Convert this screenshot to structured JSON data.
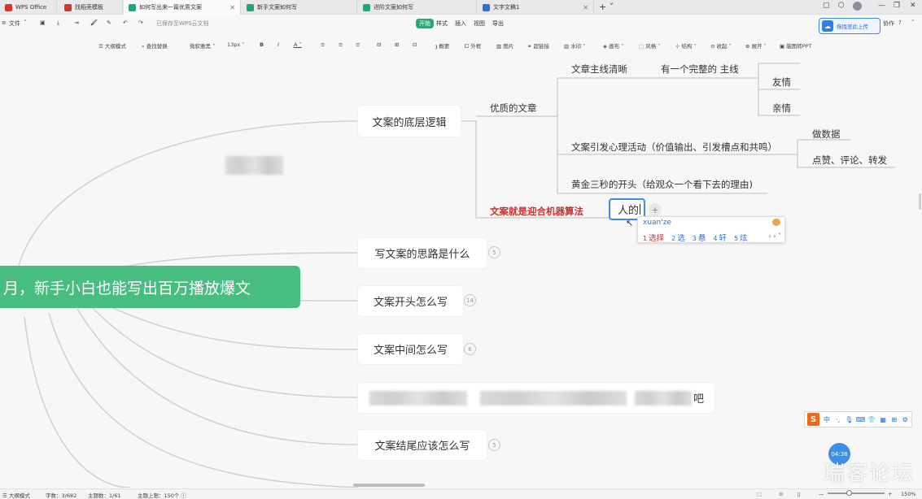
{
  "tabs": [
    {
      "label": "WPS Office",
      "active": false
    },
    {
      "label": "找稻壳模板",
      "active": false
    },
    {
      "label": "如何写出来一篇优质文案",
      "active": true
    },
    {
      "label": "新手文案如何写",
      "active": false
    },
    {
      "label": "进阶文案如何写",
      "active": false
    },
    {
      "label": "文字文稿1",
      "active": false
    }
  ],
  "toolbar1": {
    "file_menu": "文件",
    "saved_status": "已保存至WPS云文档",
    "menu_tabs": [
      "开始",
      "样式",
      "插入",
      "视图",
      "导出"
    ],
    "right_label": "协作",
    "upload_label": "拖拽至此上传"
  },
  "toolbar2": {
    "items": [
      "大纲模式",
      "查找替换",
      "微软雅黑",
      "13px",
      "B",
      "I",
      "A",
      "概要",
      "外框",
      "图片",
      "超链接",
      "水印",
      "画布",
      "风格",
      "结构",
      "收起",
      "展开",
      "脑图转PPT"
    ]
  },
  "mindmap": {
    "root": "月，新手小白也能写出百万播放爆文",
    "branches": [
      {
        "label": "文案的底层逻辑",
        "badge": ""
      },
      {
        "label": "写文案的思路是什么",
        "badge": "5"
      },
      {
        "label": "文案开头怎么写",
        "badge": "14"
      },
      {
        "label": "文案中间怎么写",
        "badge": "6"
      },
      {
        "label": "文案结尾应该怎么写",
        "badge": "5"
      }
    ],
    "sub": {
      "quality": "优质的文章",
      "algorithm": "文案就是迎合机器算法",
      "mainline": "文章主线清晰",
      "complete": "有一个完整的 主线",
      "friendship": "友情",
      "family": "亲情",
      "psych": "文案引发心理活动（价值输出、引发槽点和共鸣）",
      "data": "做数据",
      "engage": "点赞、评论、转发",
      "golden": "黄金三秒的开头（给观众一个看下去的理由)",
      "editing_text": "人的"
    },
    "blurred_tail": "吧"
  },
  "ime": {
    "pinyin": "xuan'ze",
    "candidates": [
      {
        "n": "1",
        "text": "选择"
      },
      {
        "n": "2",
        "text": "选"
      },
      {
        "n": "3",
        "text": "悬"
      },
      {
        "n": "4",
        "text": "轩"
      },
      {
        "n": "5",
        "text": "炫"
      }
    ]
  },
  "sogou_bar": {
    "mode": "中"
  },
  "timer": "04:38",
  "watermark": "瑞客论坛",
  "status": {
    "outline": "大纲模式",
    "word_count": "字数：3/682",
    "topic_count": "主题数：1/61",
    "topic_limit": "主题上限：150个",
    "zoom": "150%"
  },
  "colors": {
    "accent": "#47bd7f",
    "root_bg": "#47bd7f",
    "highlight_red": "#c8302f",
    "edit_border": "#3b8fe6"
  }
}
